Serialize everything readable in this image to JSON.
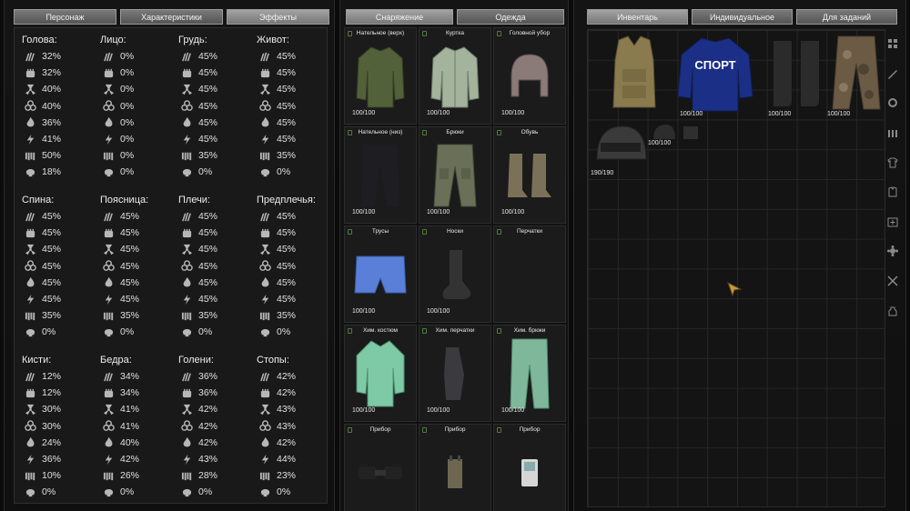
{
  "left_tabs": [
    "Персонаж",
    "Характеристики",
    "Эффекты"
  ],
  "mid_tabs": [
    "Снаряжение",
    "Одежда"
  ],
  "right_tabs": [
    "Инвентарь",
    "Индивидуальное",
    "Для заданий"
  ],
  "resist_icons": [
    "claw-icon",
    "fist-icon",
    "radiation-icon",
    "biohazard-icon",
    "fire-icon",
    "lightning-icon",
    "acid-icon",
    "psy-skull-icon"
  ],
  "body_parts": [
    {
      "name": "Голова:",
      "values": [
        "32%",
        "32%",
        "40%",
        "40%",
        "36%",
        "41%",
        "50%",
        "18%"
      ]
    },
    {
      "name": "Лицо:",
      "values": [
        "0%",
        "0%",
        "0%",
        "0%",
        "0%",
        "0%",
        "0%",
        "0%"
      ]
    },
    {
      "name": "Грудь:",
      "values": [
        "45%",
        "45%",
        "45%",
        "45%",
        "45%",
        "45%",
        "35%",
        "0%"
      ]
    },
    {
      "name": "Живот:",
      "values": [
        "45%",
        "45%",
        "45%",
        "45%",
        "45%",
        "45%",
        "35%",
        "0%"
      ]
    },
    {
      "name": "Спина:",
      "values": [
        "45%",
        "45%",
        "45%",
        "45%",
        "45%",
        "45%",
        "35%",
        "0%"
      ]
    },
    {
      "name": "Поясница:",
      "values": [
        "45%",
        "45%",
        "45%",
        "45%",
        "45%",
        "45%",
        "35%",
        "0%"
      ]
    },
    {
      "name": "Плечи:",
      "values": [
        "45%",
        "45%",
        "45%",
        "45%",
        "45%",
        "45%",
        "35%",
        "0%"
      ]
    },
    {
      "name": "Предплечья:",
      "values": [
        "45%",
        "45%",
        "45%",
        "45%",
        "45%",
        "45%",
        "35%",
        "0%"
      ]
    },
    {
      "name": "Кисти:",
      "values": [
        "12%",
        "12%",
        "30%",
        "30%",
        "24%",
        "36%",
        "10%",
        "0%"
      ]
    },
    {
      "name": "Бедра:",
      "values": [
        "34%",
        "34%",
        "41%",
        "41%",
        "40%",
        "42%",
        "26%",
        "0%"
      ]
    },
    {
      "name": "Голени:",
      "values": [
        "36%",
        "36%",
        "42%",
        "42%",
        "42%",
        "43%",
        "28%",
        "0%"
      ]
    },
    {
      "name": "Стопы:",
      "values": [
        "42%",
        "42%",
        "43%",
        "43%",
        "42%",
        "44%",
        "23%",
        "0%"
      ]
    }
  ],
  "slots": [
    {
      "label": "Нательное (верх)",
      "condition": "100/100",
      "art": "undershirt-top"
    },
    {
      "label": "Куртка",
      "condition": "100/100",
      "art": "jacket"
    },
    {
      "label": "Головной убор",
      "condition": "100/100",
      "art": "ushanka-hat"
    },
    {
      "label": "Нательное (низ)",
      "condition": "100/100",
      "art": "underpants-long"
    },
    {
      "label": "Брюки",
      "condition": "100/100",
      "art": "cargo-pants"
    },
    {
      "label": "Обувь",
      "condition": "100/100",
      "art": "boots"
    },
    {
      "label": "Трусы",
      "condition": "100/100",
      "art": "shorts"
    },
    {
      "label": "Носки",
      "condition": "100/100",
      "art": "sock"
    },
    {
      "label": "Перчатки",
      "condition": "",
      "art": ""
    },
    {
      "label": "Хим. костюм",
      "condition": "100/100",
      "art": "chem-suit"
    },
    {
      "label": "Хим. перчатки",
      "condition": "100/100",
      "art": "chem-gloves"
    },
    {
      "label": "Хим. брюки",
      "condition": "100/100",
      "art": "chem-pants"
    },
    {
      "label": "Прибор",
      "condition": "",
      "art": "nightvision"
    },
    {
      "label": "Прибор",
      "condition": "",
      "art": "detector"
    },
    {
      "label": "Прибор",
      "condition": "",
      "art": "pda"
    }
  ],
  "inventory": [
    {
      "name": "vest",
      "condition": ""
    },
    {
      "name": "sport-tracksuit-top",
      "print": "СПОРТ",
      "condition": "100/100"
    },
    {
      "name": "rubber-boots",
      "condition": "100/100"
    },
    {
      "name": "camo-pants",
      "condition": "100/100"
    },
    {
      "name": "helmet",
      "condition": "190/190"
    },
    {
      "name": "cap",
      "condition": "100/100"
    },
    {
      "name": "small-item",
      "condition": ""
    }
  ],
  "side_icons": [
    "grid-icon",
    "knife-icon",
    "gear-icon",
    "ammo-icon",
    "tshirt-icon",
    "armor-vest-icon",
    "medkit-icon",
    "artifact-icon",
    "crossed-tools-icon",
    "bag-icon"
  ],
  "colors": {
    "tab": "#6a6a6a",
    "panel": "#141414",
    "accent_green": "#4f7a3f",
    "text": "#e6e6e6"
  }
}
